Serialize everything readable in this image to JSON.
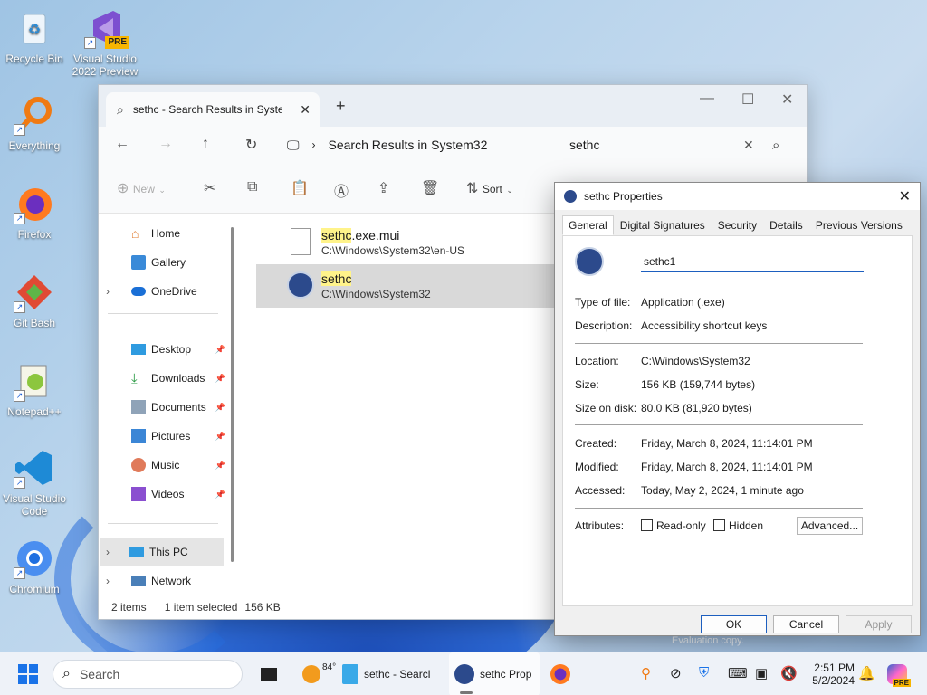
{
  "desktop": {
    "icons": [
      {
        "label": "Recycle Bin"
      },
      {
        "label": "Visual Studio 2022 Preview",
        "badge": "PRE"
      },
      {
        "label": "Everything"
      },
      {
        "label": "Firefox"
      },
      {
        "label": "Git Bash"
      },
      {
        "label": "Notepad++"
      },
      {
        "label": "Visual Studio Code"
      },
      {
        "label": "Chromium"
      }
    ],
    "watermark": "Evaluation copy."
  },
  "explorer": {
    "tab_title": "sethc - Search Results in System32",
    "address": "Search Results in System32",
    "search_value": "sethc",
    "commands": {
      "new": "New",
      "sort": "Sort"
    },
    "nav": [
      {
        "label": "Home",
        "icon": "home-icon"
      },
      {
        "label": "Gallery",
        "icon": "gallery-icon"
      },
      {
        "label": "OneDrive",
        "icon": "cloud-icon"
      },
      {
        "label": "Desktop",
        "icon": "desktop-icon"
      },
      {
        "label": "Downloads",
        "icon": "download-icon"
      },
      {
        "label": "Documents",
        "icon": "documents-icon"
      },
      {
        "label": "Pictures",
        "icon": "pictures-icon"
      },
      {
        "label": "Music",
        "icon": "music-icon"
      },
      {
        "label": "Videos",
        "icon": "videos-icon"
      },
      {
        "label": "This PC",
        "icon": "computer-icon"
      },
      {
        "label": "Network",
        "icon": "network-icon"
      }
    ],
    "files": [
      {
        "name_hl": "sethc",
        "name_rest": ".exe.mui",
        "path": "C:\\Windows\\System32\\en-US"
      },
      {
        "name_hl": "sethc",
        "name_rest": "",
        "path": "C:\\Windows\\System32"
      }
    ],
    "status": {
      "count": "2 items",
      "selected": "1 item selected",
      "size": "156 KB"
    }
  },
  "properties": {
    "title": "sethc Properties",
    "tabs": [
      "General",
      "Digital Signatures",
      "Security",
      "Details",
      "Previous Versions"
    ],
    "name_value": "sethc1",
    "fields": {
      "type_label": "Type of file:",
      "type_value": "Application (.exe)",
      "desc_label": "Description:",
      "desc_value": "Accessibility shortcut keys",
      "location_label": "Location:",
      "location_value": "C:\\Windows\\System32",
      "size_label": "Size:",
      "size_value": "156 KB (159,744 bytes)",
      "disk_label": "Size on disk:",
      "disk_value": "80.0 KB (81,920 bytes)",
      "created_label": "Created:",
      "created_value": "Friday, March 8, 2024, 11:14:01 PM",
      "modified_label": "Modified:",
      "modified_value": "Friday, March 8, 2024, 11:14:01 PM",
      "accessed_label": "Accessed:",
      "accessed_value": "Today, May 2, 2024, 1 minute ago",
      "attr_label": "Attributes:",
      "readonly": "Read-only",
      "hidden": "Hidden",
      "advanced": "Advanced..."
    },
    "buttons": {
      "ok": "OK",
      "cancel": "Cancel",
      "apply": "Apply"
    }
  },
  "taskbar": {
    "search_placeholder": "Search",
    "weather": "84°",
    "apps": [
      {
        "label": "sethc - Searcl"
      },
      {
        "label": "sethc Prop"
      }
    ],
    "time": "2:51 PM",
    "date": "5/2/2024",
    "badge": "PRE"
  },
  "colors": {
    "accent": "#1d5fbf",
    "highlight": "#fff38a",
    "selection": "#d9d9d9"
  }
}
